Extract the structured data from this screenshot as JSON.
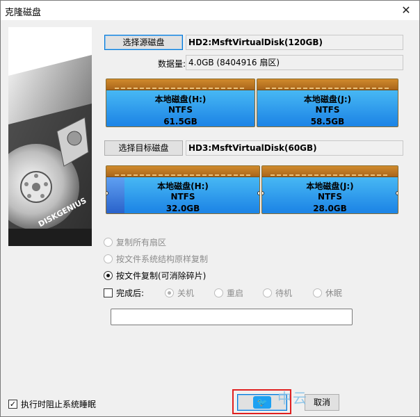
{
  "window": {
    "title": "克隆磁盘",
    "close_glyph": "✕"
  },
  "source": {
    "button_label": "选择源磁盘",
    "disk_name": "HD2:MsftVirtualDisk(120GB)",
    "amount_label": "数据量:",
    "amount_value": "4.0GB (8404916 扇区)",
    "partitions": [
      {
        "name": "本地磁盘(H:)",
        "fs": "NTFS",
        "size": "61.5GB",
        "used_fraction": 0.0
      },
      {
        "name": "本地磁盘(J:)",
        "fs": "NTFS",
        "size": "58.5GB",
        "used_fraction": 0.0
      }
    ]
  },
  "target": {
    "button_label": "选择目标磁盘",
    "disk_name": "HD3:MsftVirtualDisk(60GB)",
    "partitions": [
      {
        "name": "本地磁盘(H:)",
        "fs": "NTFS",
        "size": "32.0GB",
        "used_fraction": 0.12
      },
      {
        "name": "本地磁盘(J:)",
        "fs": "NTFS",
        "size": "28.0GB",
        "used_fraction": 0.0
      }
    ]
  },
  "mode": {
    "options": [
      {
        "label": "复制所有扇区",
        "selected": false,
        "enabled": false
      },
      {
        "label": "按文件系统结构原样复制",
        "selected": false,
        "enabled": false
      },
      {
        "label": "按文件复制(可消除碎片)",
        "selected": true,
        "enabled": true
      }
    ]
  },
  "after": {
    "checkbox_label": "完成后:",
    "checked": false,
    "options": [
      "关机",
      "重启",
      "待机",
      "休眠"
    ],
    "selected": "关机"
  },
  "progress_text": "",
  "prevent_sleep": {
    "label": "执行时阻止系统睡眠",
    "checked": true
  },
  "buttons": {
    "start_label": "开始",
    "cancel_label": "取消"
  },
  "brand": {
    "logo_text": "DISKGENIUS"
  },
  "watermark": {
    "text": "中云"
  }
}
